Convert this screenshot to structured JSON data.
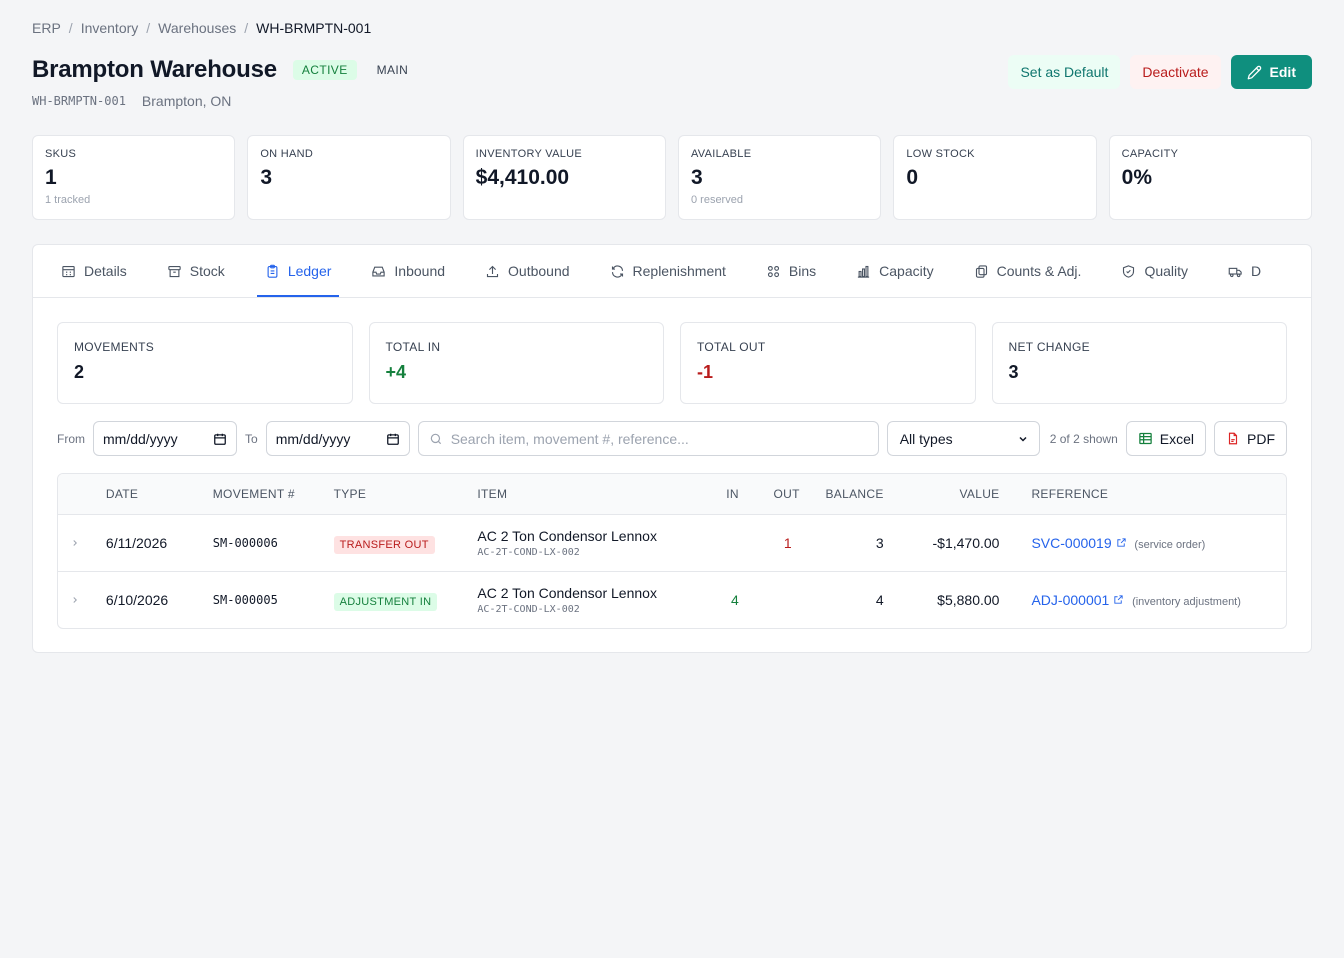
{
  "breadcrumb": [
    "ERP",
    "Inventory",
    "Warehouses",
    "WH-BRMPTN-001"
  ],
  "header": {
    "title": "Brampton Warehouse",
    "status": "ACTIVE",
    "tag": "MAIN",
    "code": "WH-BRMPTN-001",
    "location": "Brampton, ON",
    "set_default_label": "Set as Default",
    "deactivate_label": "Deactivate",
    "edit_label": "Edit"
  },
  "stats": [
    {
      "label": "SKUS",
      "value": "1",
      "sub": "1 tracked"
    },
    {
      "label": "ON HAND",
      "value": "3",
      "sub": ""
    },
    {
      "label": "INVENTORY VALUE",
      "value": "$4,410.00",
      "sub": ""
    },
    {
      "label": "AVAILABLE",
      "value": "3",
      "sub": "0 reserved"
    },
    {
      "label": "LOW STOCK",
      "value": "0",
      "sub": ""
    },
    {
      "label": "CAPACITY",
      "value": "0%",
      "sub": ""
    }
  ],
  "tabs": [
    {
      "label": "Details",
      "icon": "building-icon"
    },
    {
      "label": "Stock",
      "icon": "archive-icon"
    },
    {
      "label": "Ledger",
      "icon": "clipboard-icon"
    },
    {
      "label": "Inbound",
      "icon": "inbox-icon"
    },
    {
      "label": "Outbound",
      "icon": "upload-icon"
    },
    {
      "label": "Replenishment",
      "icon": "refresh-icon"
    },
    {
      "label": "Bins",
      "icon": "grid-icon"
    },
    {
      "label": "Capacity",
      "icon": "bar-chart-icon"
    },
    {
      "label": "Counts & Adj.",
      "icon": "copy-icon"
    },
    {
      "label": "Quality",
      "icon": "shield-icon"
    },
    {
      "label": "D",
      "icon": "truck-icon"
    }
  ],
  "ledger_stats": [
    {
      "label": "MOVEMENTS",
      "value": "2",
      "tone": ""
    },
    {
      "label": "TOTAL IN",
      "value": "+4",
      "tone": "pos"
    },
    {
      "label": "TOTAL OUT",
      "value": "-1",
      "tone": "neg"
    },
    {
      "label": "NET CHANGE",
      "value": "3",
      "tone": ""
    }
  ],
  "filters": {
    "from_label": "From",
    "from_value": "mm/dd/yyyy",
    "to_label": "To",
    "to_value": "mm/dd/yyyy",
    "search_placeholder": "Search item, movement #, reference...",
    "type_selected": "All types",
    "shown_text": "2 of 2 shown",
    "excel_label": "Excel",
    "pdf_label": "PDF"
  },
  "table": {
    "columns": [
      "DATE",
      "MOVEMENT #",
      "TYPE",
      "ITEM",
      "IN",
      "OUT",
      "BALANCE",
      "VALUE",
      "REFERENCE"
    ],
    "rows": [
      {
        "date": "6/11/2026",
        "movement": "SM-000006",
        "type": "TRANSFER OUT",
        "type_tone": "out",
        "item": "AC 2 Ton Condensor Lennox",
        "sku": "AC-2T-COND-LX-002",
        "in": "",
        "out": "1",
        "balance": "3",
        "value": "-$1,470.00",
        "ref": "SVC-000019",
        "ref_sub": "(service order)"
      },
      {
        "date": "6/10/2026",
        "movement": "SM-000005",
        "type": "ADJUSTMENT IN",
        "type_tone": "in",
        "item": "AC 2 Ton Condensor Lennox",
        "sku": "AC-2T-COND-LX-002",
        "in": "4",
        "out": "",
        "balance": "4",
        "value": "$5,880.00",
        "ref": "ADJ-000001",
        "ref_sub": "(inventory adjustment)"
      }
    ]
  },
  "colors": {
    "accent": "#2563eb",
    "primary_button": "#0f8f7e",
    "positive": "#15803d",
    "negative": "#b91c1c"
  }
}
